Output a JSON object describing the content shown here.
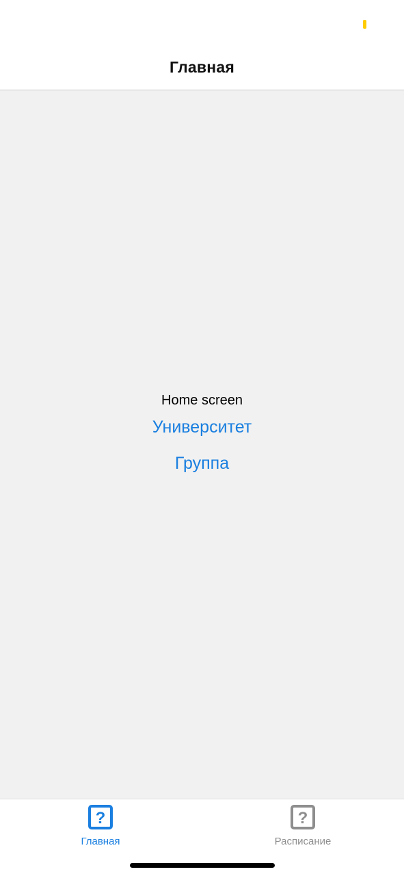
{
  "nav": {
    "title": "Главная"
  },
  "content": {
    "home_text": "Home screen",
    "university_link": "Университет",
    "group_link": "Группа"
  },
  "tabs": [
    {
      "label": "Главная",
      "icon": "question-box-icon",
      "active": true,
      "color": "#1a7fe0"
    },
    {
      "label": "Расписание",
      "icon": "question-box-icon",
      "active": false,
      "color": "#8e8e8e"
    }
  ],
  "colors": {
    "accent": "#1a7fe0",
    "background": "#f1f1f1",
    "status_indicator": "#ffcc00"
  }
}
